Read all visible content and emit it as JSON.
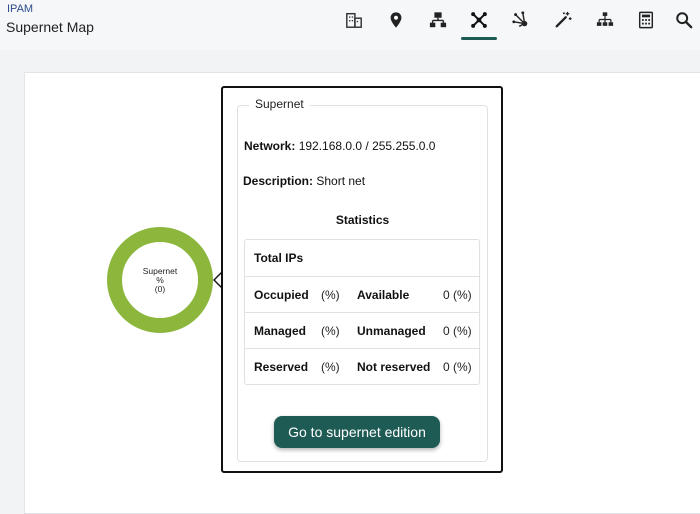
{
  "header": {
    "breadcrumb": "IPAM",
    "title": "Supernet Map",
    "toolbar": [
      {
        "icon": "building-icon"
      },
      {
        "icon": "location-pin-icon"
      },
      {
        "icon": "network-tree-icon"
      },
      {
        "icon": "supernet-map-icon",
        "active": true
      },
      {
        "icon": "network-nodes-icon"
      },
      {
        "icon": "magic-wand-icon"
      },
      {
        "icon": "hierarchy-icon"
      },
      {
        "icon": "calculator-icon"
      },
      {
        "icon": "search-icon"
      }
    ],
    "active_color": "#1e5b55"
  },
  "map": {
    "node": {
      "title": "Supernet",
      "percent": "%",
      "count": "(0)",
      "ring_color": "#8cb63c"
    }
  },
  "popup": {
    "legend": "Supernet",
    "network_label": "Network:",
    "network_value": "192.168.0.0 / 255.255.0.0",
    "description_label": "Description:",
    "description_value": "Short net",
    "statistics_title": "Statistics",
    "stats": {
      "total_label": "Total IPs",
      "rows": [
        {
          "left_label": "Occupied",
          "left_pct": "(%)",
          "right_label": "Available",
          "right_value": "0 (%)"
        },
        {
          "left_label": "Managed",
          "left_pct": "(%)",
          "right_label": "Unmanaged",
          "right_value": "0 (%)"
        },
        {
          "left_label": "Reserved",
          "left_pct": "(%)",
          "right_label": "Not reserved",
          "right_value": "0 (%)"
        }
      ]
    },
    "button_label": "Go to supernet edition"
  }
}
